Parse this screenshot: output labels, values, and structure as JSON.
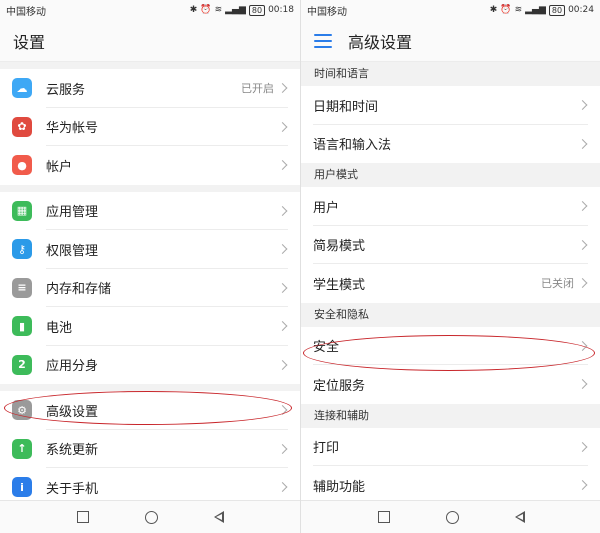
{
  "left": {
    "status": {
      "carrier": "中国移动",
      "battery": "80",
      "time": "00:18"
    },
    "title": "设置",
    "groups": [
      [
        {
          "label": "云服务",
          "value": "已开启",
          "icon_color": "#3ea8f5",
          "icon": "cloud-icon"
        },
        {
          "label": "华为帐号",
          "icon_color": "#e04a3f",
          "icon": "huawei-icon"
        },
        {
          "label": "帐户",
          "icon_color": "#f15b4b",
          "icon": "account-icon"
        }
      ],
      [
        {
          "label": "应用管理",
          "icon_color": "#3dbb5a",
          "icon": "apps-icon"
        },
        {
          "label": "权限管理",
          "icon_color": "#2b9ae8",
          "icon": "key-icon"
        },
        {
          "label": "内存和存储",
          "icon_color": "#9a9a9a",
          "icon": "storage-icon"
        },
        {
          "label": "电池",
          "icon_color": "#3dbb5a",
          "icon": "battery-icon"
        },
        {
          "label": "应用分身",
          "icon_color": "#3dbb5a",
          "icon": "twin-app-icon"
        }
      ],
      [
        {
          "label": "高级设置",
          "icon_color": "#9a9a9a",
          "icon": "gear-icon"
        },
        {
          "label": "系统更新",
          "icon_color": "#3dbb5a",
          "icon": "update-icon"
        },
        {
          "label": "关于手机",
          "icon_color": "#2b7de9",
          "icon": "info-icon"
        }
      ]
    ]
  },
  "right": {
    "status": {
      "carrier": "中国移动",
      "battery": "80",
      "time": "00:24"
    },
    "title": "高级设置",
    "sections": [
      {
        "header": "时间和语言",
        "items": [
          {
            "label": "日期和时间"
          },
          {
            "label": "语言和输入法"
          }
        ]
      },
      {
        "header": "用户模式",
        "items": [
          {
            "label": "用户"
          },
          {
            "label": "简易模式"
          },
          {
            "label": "学生模式",
            "value": "已关闭"
          }
        ]
      },
      {
        "header": "安全和隐私",
        "items": [
          {
            "label": "安全"
          },
          {
            "label": "定位服务"
          }
        ]
      },
      {
        "header": "连接和辅助",
        "items": [
          {
            "label": "打印"
          },
          {
            "label": "辅助功能"
          }
        ]
      }
    ]
  },
  "colors": {
    "accent": "#2b7de9",
    "highlight": "#c8262b"
  }
}
